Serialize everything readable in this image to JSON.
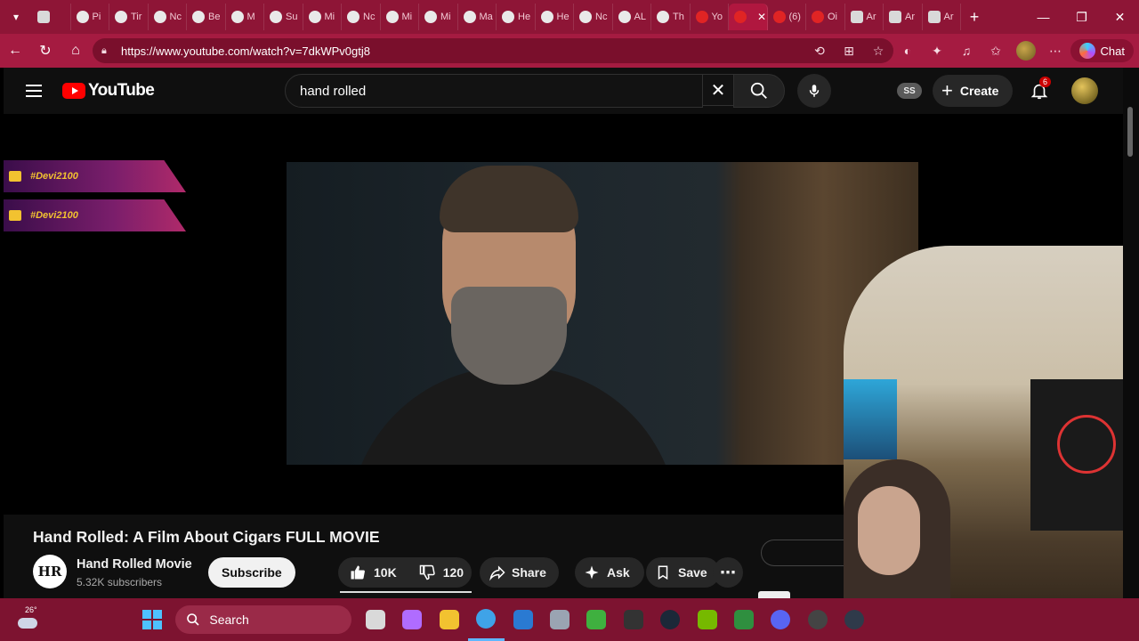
{
  "browser": {
    "tabs": [
      {
        "title": "",
        "icon": "grid-icon"
      },
      {
        "title": "Pi",
        "icon": "leaf-icon"
      },
      {
        "title": "Tir",
        "icon": "leaf-icon"
      },
      {
        "title": "Nc",
        "icon": "leaf-icon"
      },
      {
        "title": "Be",
        "icon": "leaf-icon"
      },
      {
        "title": "M",
        "icon": "leaf-icon"
      },
      {
        "title": "Su",
        "icon": "leaf-icon"
      },
      {
        "title": "Mi",
        "icon": "face-icon"
      },
      {
        "title": "Nc",
        "icon": "face-icon"
      },
      {
        "title": "Mi",
        "icon": "face-icon"
      },
      {
        "title": "Mi",
        "icon": "face-icon"
      },
      {
        "title": "Ma",
        "icon": "face-icon"
      },
      {
        "title": "He",
        "icon": "face-icon"
      },
      {
        "title": "He",
        "icon": "face-icon"
      },
      {
        "title": "Nc",
        "icon": "face-icon"
      },
      {
        "title": "AL",
        "icon": "face-icon"
      },
      {
        "title": "Th",
        "icon": "face-icon"
      },
      {
        "title": "Yo",
        "icon": "youtube-icon"
      },
      {
        "title": "",
        "icon": "youtube-icon",
        "active": true
      },
      {
        "title": "(6)",
        "icon": "youtube-icon"
      },
      {
        "title": "Oi",
        "icon": "record-icon"
      },
      {
        "title": "Ar",
        "icon": "a-icon"
      },
      {
        "title": "Ar",
        "icon": "a-icon"
      },
      {
        "title": "Ar",
        "icon": "a-icon"
      }
    ],
    "url": "https://www.youtube.com/watch?v=7dkWPv0gtj8",
    "chat_label": "Chat"
  },
  "youtube": {
    "logo_text": "YouTube",
    "search_value": "hand rolled",
    "ss_badge": "SS",
    "create_label": "Create",
    "notification_count": "6"
  },
  "overlay": {
    "twitter_handle": "#Devi2100",
    "youtube_handle": "#Devi2100"
  },
  "video": {
    "title": "Hand Rolled: A Film About Cigars FULL MOVIE",
    "channel_initials": "HR",
    "channel_name": "Hand Rolled Movie",
    "subscribers": "5.32K subscribers",
    "subscribe_label": "Subscribe",
    "likes": "10K",
    "dislikes": "120",
    "share_label": "Share",
    "ask_label": "Ask",
    "save_label": "Save"
  },
  "taskbar": {
    "temperature": "26°",
    "search_label": "Search",
    "apps": [
      "file-explorer-icon",
      "copilot-icon",
      "folder-icon",
      "edge-icon",
      "outlook-icon",
      "settings-icon",
      "xbox-icon",
      "epic-games-icon",
      "steam-icon",
      "nvidia-icon",
      "app-icon",
      "discord-icon",
      "obs-icon",
      "speedometer-icon"
    ]
  }
}
